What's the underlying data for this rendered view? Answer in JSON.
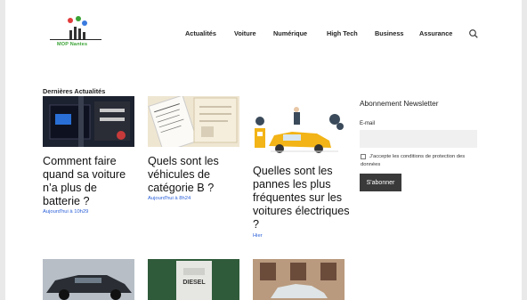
{
  "header": {
    "logo_text": "MOP Nantes",
    "nav": [
      "Actualités",
      "Voiture",
      "Numérique",
      "High Tech",
      "Business",
      "Assurance"
    ],
    "search_icon": "search-icon"
  },
  "section": {
    "title": "Dernières Actualités"
  },
  "articles": [
    {
      "title": "Comment faire quand sa voiture n’a plus de batterie ?",
      "date": "Aujourd'hui à 10h29"
    },
    {
      "title": "Quels sont les véhicules de catégorie B ?",
      "date": "Aujourd'hui à 8h24"
    },
    {
      "title": "Quelles sont les pannes les plus fréquentes sur les voitures électriques ?",
      "date": "Hier"
    }
  ],
  "newsletter": {
    "title": "Abonnement Newsletter",
    "email_label": "E-mail",
    "email_value": "",
    "consent": "J'accepte les conditions de protection des données",
    "submit": "S'abonner"
  },
  "colors": {
    "accent": "#2a5fd8",
    "logo_green": "#3aa335",
    "button": "#3a3a3a"
  }
}
